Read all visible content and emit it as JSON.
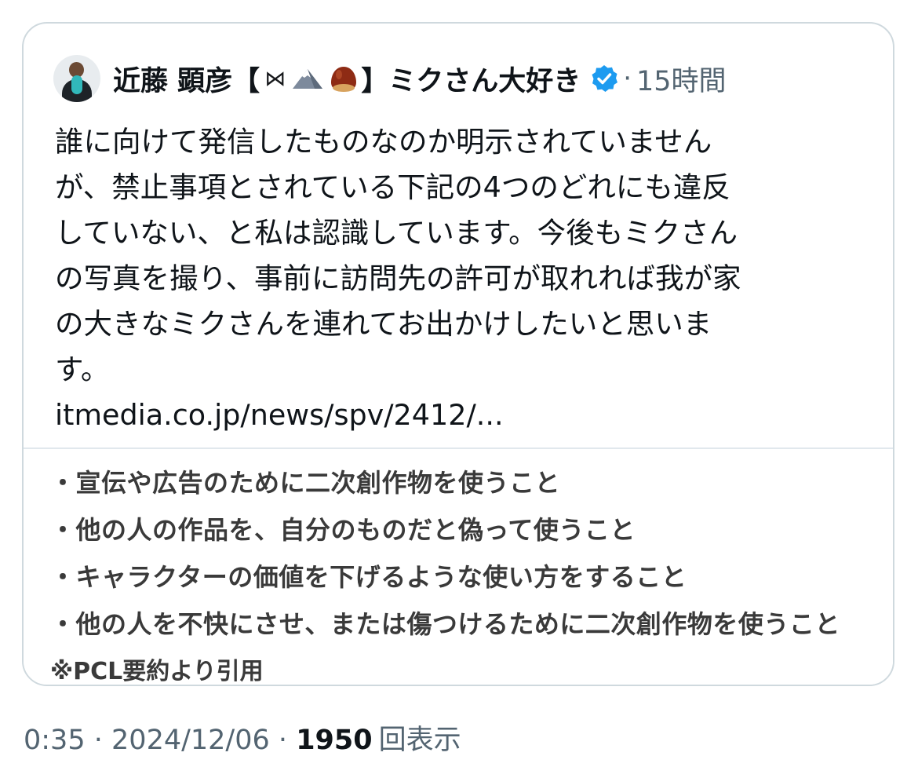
{
  "quoted_post": {
    "author": {
      "name_part1": "近藤 顕彦【",
      "bowtie_symbol": "⋈",
      "name_part2": "】ミクさん大好き",
      "badge_icons": [
        "bowtie-icon",
        "mountain-icon",
        "chestnut-icon"
      ],
      "verified_icon": "verified-badge-icon",
      "verified_color": "#1d9bf0"
    },
    "separator": "·",
    "time_ago": "15時間",
    "text_lines": [
      "誰に向けて発信したものなのか明示されていません",
      "が、禁止事項とされている下記の4つのどれにも違反",
      "していない、と私は認識しています。今後もミクさん",
      "の写真を撮り、事前に訪問先の許可が取れれば我が家",
      "の大きなミクさんを連れてお出かけしたいと思いま",
      "す。"
    ],
    "link": "itmedia.co.jp/news/spv/2412/...",
    "image": {
      "rules": [
        "・宣伝や広告のために二次創作物を使うこと",
        "・他の人の作品を、自分のものだと偽って使うこと",
        "・キャラクターの価値を下げるような使い方をすること",
        "・他の人を不快にさせ、または傷つけるために二次創作物を使うこと"
      ],
      "citation": "※PCL要約より引用"
    }
  },
  "footer": {
    "time": "0:35",
    "separator": "·",
    "date": "2024/12/06",
    "views_count": "1950",
    "views_label": "回表示"
  },
  "colors": {
    "text_primary": "#0f1419",
    "text_secondary": "#536471",
    "border": "#cfd9de",
    "verified_blue": "#1d9bf0"
  }
}
